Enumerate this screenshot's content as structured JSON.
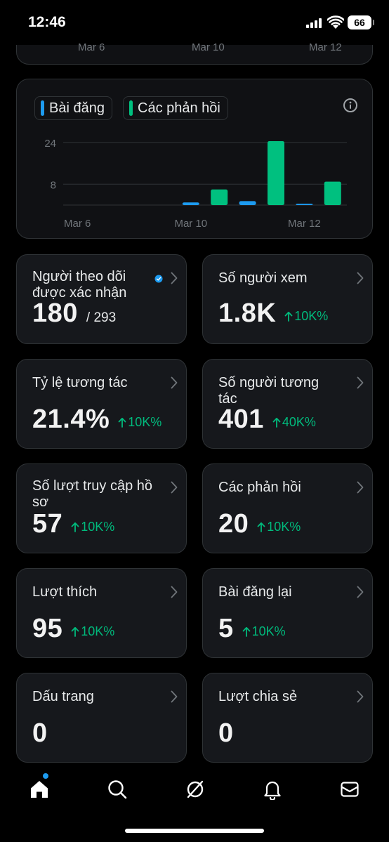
{
  "status_bar": {
    "time": "12:46",
    "battery": "66"
  },
  "top_chart": {
    "tick_labels": [
      "Mar 6",
      "Mar 10",
      "Mar 12"
    ]
  },
  "chart_data": {
    "type": "bar",
    "legend": [
      "Bài đăng",
      "Các phản hồi"
    ],
    "series": [
      {
        "name": "Bài đăng",
        "color": "#1d9bf0",
        "values": [
          0,
          0,
          0,
          0,
          1,
          0,
          1.5,
          0,
          0.5,
          0
        ]
      },
      {
        "name": "Các phản hồi",
        "color": "#00c07f",
        "values": [
          0,
          0,
          0,
          0,
          0,
          6,
          0,
          24.5,
          0,
          9
        ]
      }
    ],
    "y_ticks": [
      8,
      24
    ],
    "ylim": [
      0,
      24.5
    ],
    "x_tick_labels": [
      "Mar 6",
      "Mar 10",
      "Mar 12"
    ],
    "x_tick_positions": [
      0.5,
      4.5,
      8.5
    ],
    "grid": true
  },
  "stats": [
    {
      "label": "Người theo dõi được xác nhận",
      "value": "180",
      "sub": "/ 293",
      "change": "",
      "verified": true
    },
    {
      "label": "Số người xem",
      "value": "1.8K",
      "sub": "",
      "change": "10K%"
    },
    {
      "label": "Tỷ lệ tương tác",
      "value": "21.4%",
      "sub": "",
      "change": "10K%"
    },
    {
      "label": "Số người tương tác",
      "value": "401",
      "sub": "",
      "change": "40K%"
    },
    {
      "label": "Số lượt truy cập hồ sơ",
      "value": "57",
      "sub": "",
      "change": "10K%"
    },
    {
      "label": "Các phản hồi",
      "value": "20",
      "sub": "",
      "change": "10K%"
    },
    {
      "label": "Lượt thích",
      "value": "95",
      "sub": "",
      "change": "10K%"
    },
    {
      "label": "Bài đăng lại",
      "value": "5",
      "sub": "",
      "change": "10K%"
    },
    {
      "label": "Dấu trang",
      "value": "0",
      "sub": "",
      "change": ""
    },
    {
      "label": "Lượt chia sẻ",
      "value": "0",
      "sub": "",
      "change": ""
    }
  ],
  "nav": {
    "items": [
      "home-icon",
      "search-icon",
      "grok-icon",
      "bell-icon",
      "mail-icon"
    ],
    "home_has_notification": true
  }
}
